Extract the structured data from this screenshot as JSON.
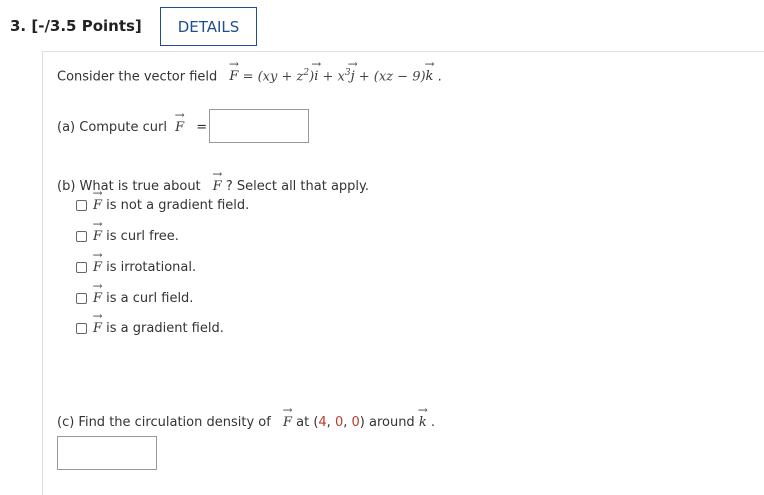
{
  "question": {
    "number_label": "3.  [-/3.5 Points]",
    "details_label": "DETAILS"
  },
  "intro": {
    "prefix": "Consider the vector field",
    "F": "F",
    "equals": " = ",
    "expr1": "(xy + z",
    "sup2": "2",
    "expr2": ")",
    "i": "i",
    "plus1": " + x",
    "sup3": "3",
    "j": "j",
    "plus2": " + (xz − 9)",
    "k": "k",
    "period": " ."
  },
  "part_a": {
    "label": "(a) Compute  curl",
    "F": "F",
    "equals": " ="
  },
  "part_b": {
    "prefix": "(b) What is true about",
    "F": "F",
    "suffix": "? Select all that apply.",
    "options": [
      {
        "F": "F",
        "text": " is not a gradient field."
      },
      {
        "F": "F",
        "text": " is curl free."
      },
      {
        "F": "F",
        "text": " is irrotational."
      },
      {
        "F": "F",
        "text": " is a curl field."
      },
      {
        "F": "F",
        "text": " is a gradient field."
      }
    ]
  },
  "part_c": {
    "prefix": "(c) Find the circulation density of",
    "F": "F",
    "at": " at ",
    "open": "(",
    "v1": "4",
    "comma1": ", ",
    "v2": "0",
    "comma2": ", ",
    "v3": "0",
    "close": ")",
    "around": " around ",
    "k": "k",
    "period": " ."
  },
  "colors": {
    "accent": "#1f4e8c",
    "point_values": "#c0392b"
  }
}
